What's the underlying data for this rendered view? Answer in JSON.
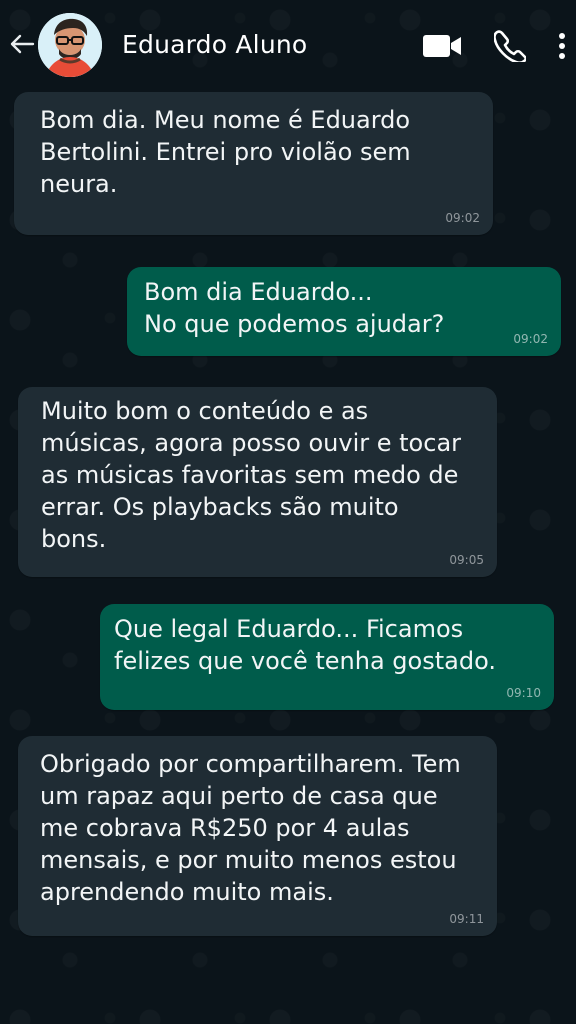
{
  "header": {
    "back_icon": "arrow-left-icon",
    "contact_name": "Eduardo Aluno",
    "video_icon": "video-camera-icon",
    "call_icon": "phone-icon",
    "menu_icon": "more-vertical-icon"
  },
  "messages": [
    {
      "direction": "incoming",
      "text": "Bom dia. Meu nome é Eduardo\nBertolini. Entrei pro violão sem\nneura.",
      "time": "09:02"
    },
    {
      "direction": "outgoing",
      "text": "Bom dia Eduardo...\nNo que podemos ajudar?",
      "time": "09:02"
    },
    {
      "direction": "incoming",
      "text": "Muito bom o conteúdo e as\nmúsicas, agora posso ouvir e tocar\nas músicas favoritas sem medo de\nerrar. Os playbacks são muito\nbons.",
      "time": "09:05"
    },
    {
      "direction": "outgoing",
      "text": "Que legal Eduardo... Ficamos\nfelizes que você tenha gostado.",
      "time": "09:10"
    },
    {
      "direction": "incoming",
      "text": "Obrigado por compartilharem. Tem\num rapaz aqui perto de casa que\nme cobrava R$250 por 4 aulas\nmensais, e por muito menos estou\naprendendo muito mais.",
      "time": "09:11"
    }
  ],
  "colors": {
    "background": "#0b141a",
    "incoming_bubble": "#1f2c34",
    "outgoing_bubble": "#005c4b",
    "text": "#f2f5f6",
    "timestamp": "#8696a0"
  }
}
